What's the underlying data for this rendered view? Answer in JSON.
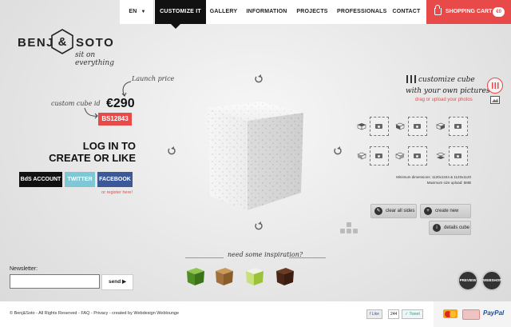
{
  "nav": {
    "language": "EN",
    "items": [
      "CUSTOMIZE IT",
      "GALLERY",
      "INFORMATION",
      "PROJECTS",
      "PROFESSIONALS",
      "CONTACT"
    ],
    "cart_label": "SHOPPING CART",
    "cart_amount": "€0"
  },
  "brand": {
    "left": "BENJ",
    "right": "SOTO",
    "ampersand": "&",
    "tagline": "sit on everything"
  },
  "product": {
    "launch_price_label": "Launch price",
    "price": "€290",
    "custom_cube_id_label": "custom cube id",
    "cube_id": "BS12843"
  },
  "login": {
    "title_line1": "LOG IN TO",
    "title_line2": "CREATE OR LIKE",
    "bs_account": "BdS ACCOUNT",
    "twitter": "TWITTER",
    "facebook": "FACEBOOK",
    "register": "or register here!"
  },
  "customize": {
    "title_line1": "customize cube",
    "title_line2": "with your own pictures",
    "upload_link": "drag or upload your photos",
    "min_dimensions": "Minimum dimensions: 1120x1344 & 1120x1120",
    "max_size": "Maximum size upload: 5MB",
    "clear_all": "clear all sides",
    "create_new": "create new cube",
    "details": "details cube",
    "info_icon_label": "i"
  },
  "inspiration": {
    "label": "need some inspiration?"
  },
  "badges": {
    "preview": "PREVIEW",
    "webshop": "WEBSHOP"
  },
  "newsletter": {
    "label": "Newsletter:",
    "value": "",
    "send": "send"
  },
  "footer": {
    "text": "© Benj&Soto - All Rights Reserved - FAQ - Privacy - created by Webdesign Weblounge",
    "like": "Like",
    "like_count": "244",
    "tweet": "Tweet",
    "paypal": "PayPal"
  },
  "colors": {
    "accent": "#e84a4a",
    "dark": "#111111",
    "twitter": "#7ec8d6",
    "facebook": "#3b5998"
  }
}
